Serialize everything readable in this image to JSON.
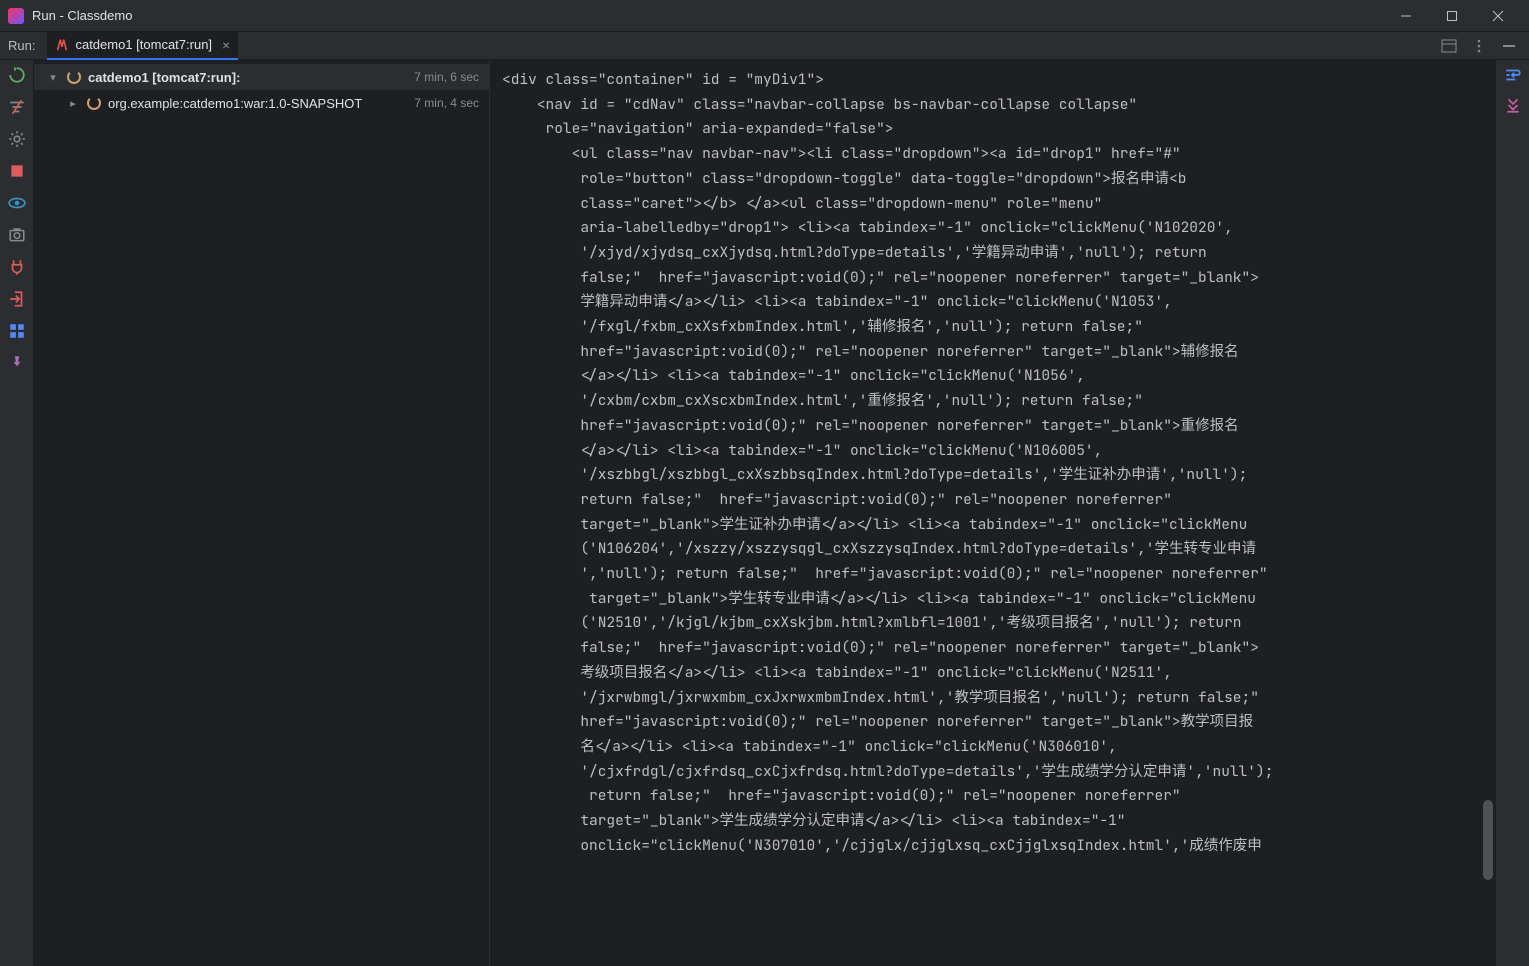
{
  "titlebar": {
    "text": "Run - Classdemo"
  },
  "run": {
    "label": "Run:",
    "tab": {
      "text": "catdemo1 [tomcat7:run]"
    }
  },
  "tree": {
    "root": {
      "text": "catdemo1 [tomcat7:run]:",
      "time": "7 min, 6 sec"
    },
    "child": {
      "text": "org.example:catdemo1:war:1.0-SNAPSHOT",
      "time": "7 min, 4 sec"
    }
  },
  "console": {
    "content": "<div class=\"container\" id = \"myDiv1\">\n    <nav id = \"cdNav\" class=\"navbar-collapse bs-navbar-collapse collapse\"\n     role=\"navigation\" aria-expanded=\"false\">\n        <ul class=\"nav navbar-nav\"><li class=\"dropdown\"><a id=\"drop1\" href=\"#\" \n         role=\"button\" class=\"dropdown-toggle\" data-toggle=\"dropdown\">报名申请<b \n         class=\"caret\"></b> </a><ul class=\"dropdown-menu\" role=\"menu\" \n         aria-labelledby=\"drop1\"> <li><a tabindex=\"-1\" onclick=\"clickMenu('N102020',\n         '/xjyd/xjydsq_cxXjydsq.html?doType=details','学籍异动申请','null'); return \n         false;\"  href=\"javascript:void(0);\" rel=\"noopener noreferrer\" target=\"_blank\">\n         学籍异动申请</a></li> <li><a tabindex=\"-1\" onclick=\"clickMenu('N1053',\n         '/fxgl/fxbm_cxXsfxbmIndex.html','辅修报名','null'); return false;\"  \n         href=\"javascript:void(0);\" rel=\"noopener noreferrer\" target=\"_blank\">辅修报名\n         </a></li> <li><a tabindex=\"-1\" onclick=\"clickMenu('N1056',\n         '/cxbm/cxbm_cxXscxbmIndex.html','重修报名','null'); return false;\"  \n         href=\"javascript:void(0);\" rel=\"noopener noreferrer\" target=\"_blank\">重修报名\n         </a></li> <li><a tabindex=\"-1\" onclick=\"clickMenu('N106005',\n         '/xszbbgl/xszbbgl_cxXszbbsqIndex.html?doType=details','学生证补办申请','null'); \n         return false;\"  href=\"javascript:void(0);\" rel=\"noopener noreferrer\" \n         target=\"_blank\">学生证补办申请</a></li> <li><a tabindex=\"-1\" onclick=\"clickMenu\n         ('N106204','/xszzy/xszzysqgl_cxXszzysqIndex.html?doType=details','学生转专业申请\n         ','null'); return false;\"  href=\"javascript:void(0);\" rel=\"noopener noreferrer\"\n          target=\"_blank\">学生转专业申请</a></li> <li><a tabindex=\"-1\" onclick=\"clickMenu\n         ('N2510','/kjgl/kjbm_cxXskjbm.html?xmlbfl=1001','考级项目报名','null'); return \n         false;\"  href=\"javascript:void(0);\" rel=\"noopener noreferrer\" target=\"_blank\">\n         考级项目报名</a></li> <li><a tabindex=\"-1\" onclick=\"clickMenu('N2511',\n         '/jxrwbmgl/jxrwxmbm_cxJxrwxmbmIndex.html','教学项目报名','null'); return false;\"  \n         href=\"javascript:void(0);\" rel=\"noopener noreferrer\" target=\"_blank\">教学项目报\n         名</a></li> <li><a tabindex=\"-1\" onclick=\"clickMenu('N306010',\n         '/cjxfrdgl/cjxfrdsq_cxCjxfrdsq.html?doType=details','学生成绩学分认定申请','null');\n          return false;\"  href=\"javascript:void(0);\" rel=\"noopener noreferrer\" \n         target=\"_blank\">学生成绩学分认定申请</a></li> <li><a tabindex=\"-1\" \n         onclick=\"clickMenu('N307010','/cjjglx/cjjglxsq_cxCjjglxsqIndex.html','成绩作废申"
  }
}
